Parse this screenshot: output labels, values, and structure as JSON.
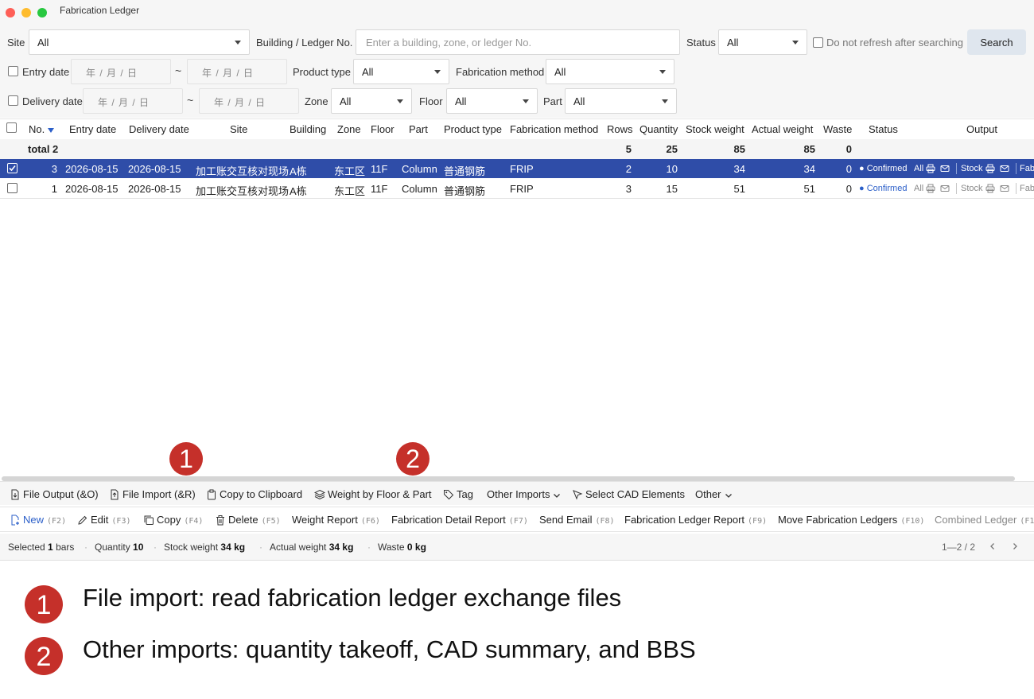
{
  "window": {
    "title": "Fabrication Ledger"
  },
  "filters": {
    "site_label": "Site",
    "site_value": "All",
    "building_label": "Building / Ledger No.",
    "building_placeholder": "Enter a building, zone, or ledger No.",
    "status_label": "Status",
    "status_value": "All",
    "no_refresh_label": "Do not refresh after searching",
    "search_label": "Search",
    "entry_date_label": "Entry date",
    "date_placeholder": "年 / 月 / 日",
    "tilde": "~",
    "product_type_label": "Product type",
    "product_type_value": "All",
    "fab_method_label": "Fabrication method",
    "fab_method_value": "All",
    "delivery_date_label": "Delivery date",
    "zone_label": "Zone",
    "zone_value": "All",
    "floor_label": "Floor",
    "floor_value": "All",
    "part_label": "Part",
    "part_value": "All"
  },
  "columns": [
    "No.",
    "Entry date",
    "Delivery date",
    "Site",
    "Building",
    "Zone",
    "Floor",
    "Part",
    "Product type",
    "Fabrication method",
    "Rows",
    "Quantity",
    "Stock weight",
    "Actual weight",
    "Waste",
    "Status",
    "Output"
  ],
  "total": {
    "label": "total 2",
    "rows": "5",
    "quantity": "25",
    "stock_weight": "85",
    "actual_weight": "85",
    "waste": "0"
  },
  "rows": [
    {
      "no": "3",
      "entry_date": "2026-08-15",
      "delivery_date": "2026-08-15",
      "site": "加工账交互核对现场",
      "building": "A栋",
      "zone": "东工区",
      "floor": "11F",
      "part": "Column",
      "product_type": "普通钢筋",
      "fab_method": "FRIP",
      "rows": "2",
      "quantity": "10",
      "stock_weight": "34",
      "actual_weight": "34",
      "waste": "0",
      "status": "● Confirmed",
      "out_all": "All",
      "out_stock": "Stock",
      "out_fab": "Fab",
      "selected": true
    },
    {
      "no": "1",
      "entry_date": "2026-08-15",
      "delivery_date": "2026-08-15",
      "site": "加工账交互核对现场",
      "building": "A栋",
      "zone": "东工区",
      "floor": "11F",
      "part": "Column",
      "product_type": "普通钢筋",
      "fab_method": "FRIP",
      "rows": "3",
      "quantity": "15",
      "stock_weight": "51",
      "actual_weight": "51",
      "waste": "0",
      "status": "● Confirmed",
      "out_all": "All",
      "out_stock": "Stock",
      "out_fab": "Fab",
      "selected": false
    }
  ],
  "toolbar1": {
    "file_output": "File Output (&O)",
    "file_import": "File Import (&R)",
    "copy_clipboard": "Copy to Clipboard",
    "weight_floor_part": "Weight by Floor & Part",
    "tag": "Tag",
    "other_imports": "Other Imports",
    "select_cad": "Select CAD Elements",
    "other": "Other"
  },
  "toolbar2": {
    "new": "New",
    "new_key": "(F2)",
    "edit": "Edit",
    "edit_key": "(F3)",
    "copy": "Copy",
    "copy_key": "(F4)",
    "delete": "Delete",
    "delete_key": "(F5)",
    "weight_report": "Weight Report",
    "weight_report_key": "(F6)",
    "fab_detail": "Fabrication Detail Report",
    "fab_detail_key": "(F7)",
    "send_email": "Send Email",
    "send_email_key": "(F8)",
    "fab_ledger_report": "Fabrication Ledger Report",
    "fab_ledger_report_key": "(F9)",
    "move_ledgers": "Move Fabrication Ledgers",
    "move_ledgers_key": "(F10)",
    "combined": "Combined Ledger",
    "combined_key": "(F1"
  },
  "statusbar": {
    "selected_prefix": "Selected",
    "selected_count": "1",
    "selected_suffix": "bars",
    "quantity_label": "Quantity",
    "quantity_value": "10",
    "stock_label": "Stock weight",
    "stock_value": "34 kg",
    "actual_label": "Actual weight",
    "actual_value": "34 kg",
    "waste_label": "Waste",
    "waste_value": "0 kg",
    "pagination": "1—2 / 2"
  },
  "callouts": {
    "one": "1",
    "two": "2"
  },
  "notes": [
    {
      "num": "1",
      "text": "File import: read fabrication ledger exchange files"
    },
    {
      "num": "2",
      "text": "Other imports: quantity takeoff, CAD summary, and BBS"
    }
  ],
  "colors": {
    "accent": "#2f4da8",
    "callout": "#c5302a",
    "link": "#2b5fc9"
  }
}
